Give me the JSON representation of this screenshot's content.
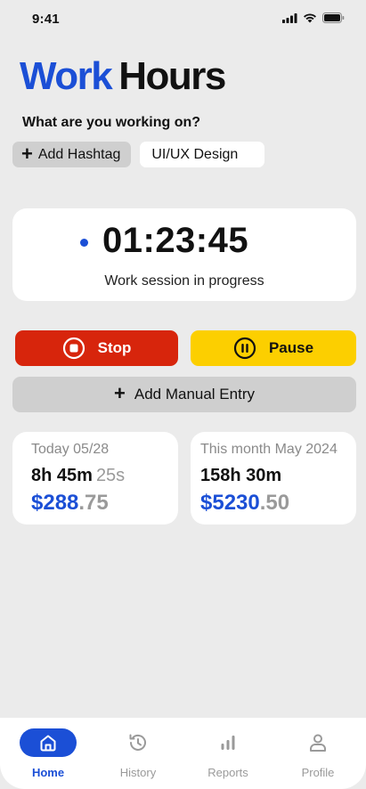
{
  "status_bar": {
    "time": "9:41"
  },
  "app": {
    "title_part1": "Work",
    "title_part2": "Hours"
  },
  "prompt": "What are you working on?",
  "hashtag": {
    "add_label": "Add Hashtag",
    "current_tag": "UI/UX Design"
  },
  "timer": {
    "value": "01:23:45",
    "status": "Work session in progress"
  },
  "actions": {
    "stop_label": "Stop",
    "pause_label": "Pause",
    "manual_label": "Add Manual Entry"
  },
  "stats": {
    "today": {
      "label": "Today 05/28",
      "hours": "8h 45m",
      "seconds": "25s",
      "amount_major": "$288",
      "amount_minor": ".75"
    },
    "month": {
      "label": "This month May 2024",
      "hours": "158h 30m",
      "amount_major": "$5230",
      "amount_minor": ".50"
    }
  },
  "nav": {
    "items": [
      {
        "label": "Home",
        "icon": "home-icon",
        "active": true
      },
      {
        "label": "History",
        "icon": "history-icon",
        "active": false
      },
      {
        "label": "Reports",
        "icon": "bar-chart-icon",
        "active": false
      },
      {
        "label": "Profile",
        "icon": "profile-icon",
        "active": false
      }
    ]
  },
  "colors": {
    "accent": "#1b4fd6",
    "stop": "#d7250c",
    "pause": "#fccf00",
    "background": "#ebebeb"
  }
}
